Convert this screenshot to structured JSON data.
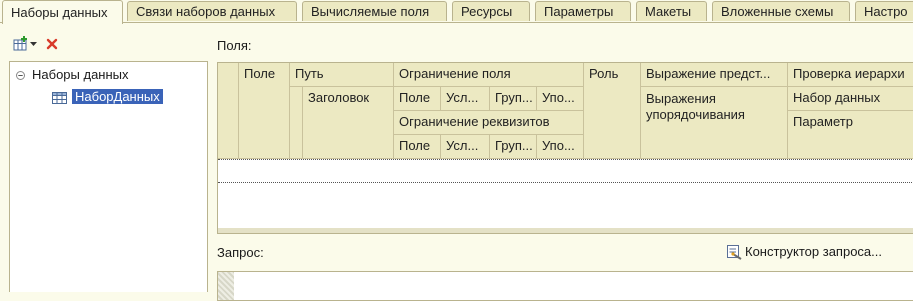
{
  "tabs": [
    {
      "label": "Наборы данных",
      "active": true
    },
    {
      "label": "Связи наборов данных",
      "active": false
    },
    {
      "label": "Вычисляемые поля",
      "active": false
    },
    {
      "label": "Ресурсы",
      "active": false
    },
    {
      "label": "Параметры",
      "active": false
    },
    {
      "label": "Макеты",
      "active": false
    },
    {
      "label": "Вложенные схемы",
      "active": false
    },
    {
      "label": "Настро",
      "active": false
    }
  ],
  "toolbar": {
    "add_icon": "add-dataset-icon",
    "dropdown_icon": "chevron-down-icon",
    "delete_icon": "delete-icon"
  },
  "tree": {
    "root": {
      "label": "Наборы данных",
      "expanded": true
    },
    "children": [
      {
        "label": "НаборДанных",
        "selected": true,
        "icon": "table-icon"
      }
    ]
  },
  "fields": {
    "label": "Поля:",
    "headers": {
      "field": "Поле",
      "path": "Путь",
      "title": "Заголовок",
      "field_restriction": "Ограничение поля",
      "attr_restriction": "Ограничение реквизитов",
      "r_field": "Поле",
      "r_cond": "Усл...",
      "r_group": "Груп...",
      "r_order": "Упо...",
      "a_field": "Поле",
      "a_cond": "Усл...",
      "a_group": "Груп...",
      "a_order": "Упо...",
      "role": "Роль",
      "repr_expr": "Выражение предст...",
      "order_expr": "Выражения упорядочивания",
      "hier_check": "Проверка иерархи",
      "dataset": "Набор данных",
      "param": "Параметр"
    }
  },
  "query": {
    "label": "Запрос:",
    "constructor_button": "Конструктор запроса..."
  },
  "colors": {
    "background": "#fbfbea",
    "header": "#ece9c2",
    "selection": "#3a63b8",
    "delete_red": "#d83a2a"
  }
}
